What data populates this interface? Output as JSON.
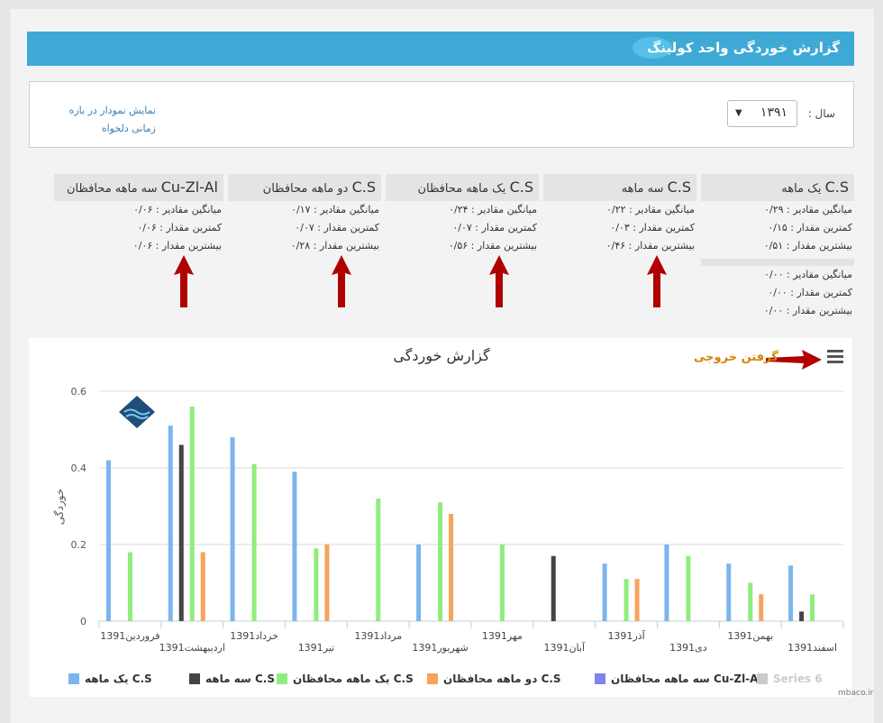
{
  "header": {
    "title": "گزارش خوردگی واحد کولینگ"
  },
  "filter": {
    "year_label": "سال :",
    "year_value": "۱۳۹۱",
    "custom_range_link": "نمایش نمودار در بازه زمانی دلخواه"
  },
  "cards": [
    {
      "title_cs": "C.S",
      "title_rest": "یک ماهه",
      "avg": "میانگین مقادیر : ۰/۲۹",
      "min": "کمترین مقدار : ۰/۱۵",
      "max": "بیشترین مقدار : ۰/۵۱",
      "extra": {
        "avg": "میانگین مقادیر : ۰/۰۰",
        "min": "کمترین مقدار : ۰/۰۰",
        "max": "بیشترین مقدار : ۰/۰۰"
      }
    },
    {
      "title_cs": "C.S",
      "title_rest": "سه ماهه",
      "avg": "میانگین مقادیر : ۰/۲۲",
      "min": "کمترین مقدار : ۰/۰۳",
      "max": "بیشترین مقدار : ۰/۴۶"
    },
    {
      "title_cs": "C.S",
      "title_rest": "یک ماهه محافظان",
      "avg": "میانگین مقادیر : ۰/۲۴",
      "min": "کمترین مقدار : ۰/۰۷",
      "max": "بیشترین مقدار : ۰/۵۶"
    },
    {
      "title_cs": "C.S",
      "title_rest": "دو ماهه محافظان",
      "avg": "میانگین مقادیر : ۰/۱۷",
      "min": "کمترین مقدار : ۰/۰۷",
      "max": "بیشترین مقدار : ۰/۲۸"
    },
    {
      "title_cs": "Cu-Zl-Al",
      "title_rest": "سه ماهه محافظان",
      "avg": "میانگین مقادیر : ۰/۰۶",
      "min": "کمترین مقدار : ۰/۰۶",
      "max": "بیشترین مقدار : ۰/۰۶"
    }
  ],
  "export_label": "گرفتن خروجی",
  "menu_icon": "hamburger-menu-icon",
  "watermark": "mbaco.ir",
  "chart_data": {
    "type": "bar",
    "title": "گزارش خوردگی",
    "ylabel": "خوردگی",
    "xlabel": "",
    "ylim": [
      0,
      0.6
    ],
    "yticks": [
      "0",
      "0.2",
      "0.4",
      "0.6"
    ],
    "categories": [
      "فروردین1391",
      "اردیبهشت1391",
      "خرداد1391",
      "تیر1391",
      "مرداد1391",
      "شهریور1391",
      "مهر1391",
      "آبان1391",
      "آذر1391",
      "دی1391",
      "بهمن1391",
      "اسفند1391"
    ],
    "legend_position": "bottom",
    "series": [
      {
        "name": "یک ماهه C.S",
        "color": "#7cb5ec",
        "values": [
          0.42,
          0.51,
          0.48,
          0.39,
          null,
          0.2,
          null,
          null,
          0.15,
          0.2,
          0.15,
          0.145
        ]
      },
      {
        "name": "سه ماهه C.S",
        "color": "#434348",
        "values": [
          null,
          0.46,
          null,
          null,
          null,
          null,
          null,
          0.17,
          null,
          null,
          null,
          0.025
        ]
      },
      {
        "name": "یک ماهه محافظان C.S",
        "color": "#90ed7d",
        "values": [
          0.18,
          0.56,
          0.41,
          0.19,
          0.32,
          0.31,
          0.2,
          null,
          0.11,
          0.17,
          0.1,
          0.07
        ]
      },
      {
        "name": "دو ماهه محافظان C.S",
        "color": "#f7a35c",
        "values": [
          null,
          0.18,
          null,
          0.2,
          null,
          0.28,
          null,
          null,
          0.11,
          null,
          0.07,
          null
        ]
      },
      {
        "name": "سه ماهه محافظان Cu-Zl-Al",
        "color": "#8085e9",
        "values": [
          null,
          null,
          null,
          null,
          null,
          null,
          null,
          null,
          null,
          null,
          null,
          null
        ]
      },
      {
        "name": "Series 6",
        "color": "#cccccc",
        "values": [
          null,
          null,
          null,
          null,
          null,
          null,
          null,
          null,
          null,
          null,
          null,
          null
        ],
        "disabled": true
      }
    ]
  }
}
